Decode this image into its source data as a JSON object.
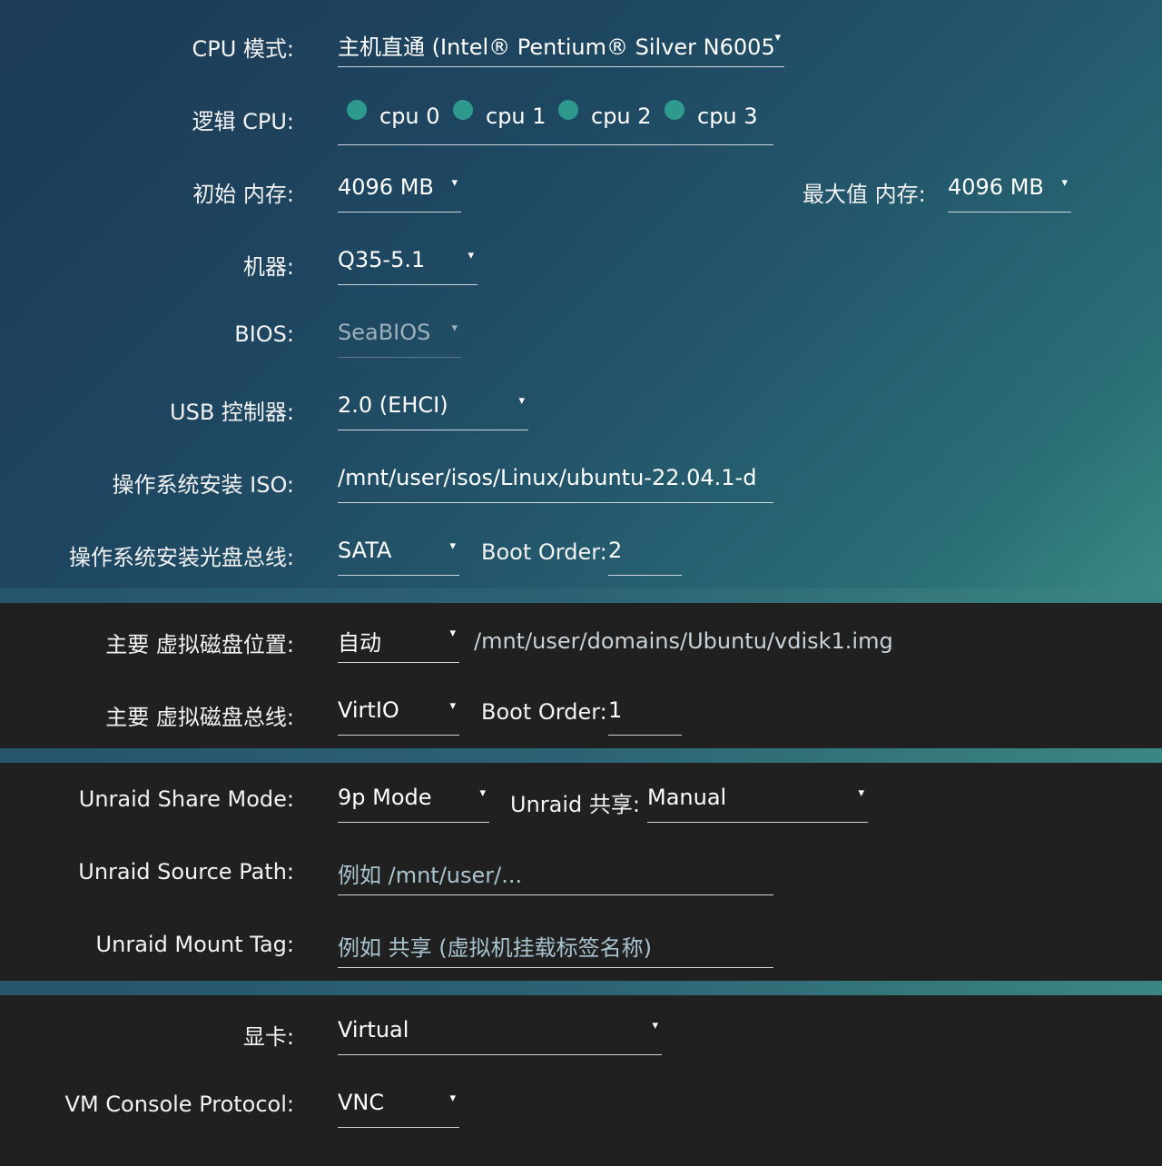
{
  "cpu_mode": {
    "label": "CPU 模式:",
    "value": "主机直通 (Intel® Pentium® Silver N6005"
  },
  "logical_cpu": {
    "label": "逻辑 CPU:",
    "cpus": [
      "cpu 0",
      "cpu 1",
      "cpu 2",
      "cpu 3"
    ]
  },
  "initial_memory": {
    "label": "初始 内存:",
    "value": "4096 MB"
  },
  "max_memory": {
    "label": "最大值 内存:",
    "value": "4096 MB"
  },
  "machine": {
    "label": "机器:",
    "value": "Q35-5.1"
  },
  "bios": {
    "label": "BIOS:",
    "value": "SeaBIOS"
  },
  "usb_controller": {
    "label": "USB 控制器:",
    "value": "2.0 (EHCI)"
  },
  "os_install_iso": {
    "label": "操作系统安装 ISO:",
    "value": "/mnt/user/isos/Linux/ubuntu-22.04.1-d"
  },
  "os_install_bus": {
    "label": "操作系统安装光盘总线:",
    "value": "SATA",
    "boot_order_label": "Boot Order:",
    "boot_order": "2"
  },
  "vdisk_location": {
    "label": "主要 虚拟磁盘位置:",
    "value": "自动",
    "path": "/mnt/user/domains/Ubuntu/vdisk1.img"
  },
  "vdisk_bus": {
    "label": "主要 虚拟磁盘总线:",
    "value": "VirtIO",
    "boot_order_label": "Boot Order:",
    "boot_order": "1"
  },
  "share_mode": {
    "label": "Unraid Share Mode:",
    "value": "9p Mode",
    "share_label": "Unraid 共享:",
    "share_value": "Manual"
  },
  "source_path": {
    "label": "Unraid Source Path:",
    "placeholder": "例如 /mnt/user/..."
  },
  "mount_tag": {
    "label": "Unraid Mount Tag:",
    "placeholder": "例如 共享 (虚拟机挂载标签名称)"
  },
  "graphics": {
    "label": "显卡:",
    "value": "Virtual"
  },
  "console_protocol": {
    "label": "VM Console Protocol:",
    "value": "VNC"
  },
  "dropdown_icon": "▾",
  "colors": {
    "accent_dot": "#2e9a8e",
    "top_bg": "#1e4660",
    "dark_bg": "#202020"
  }
}
